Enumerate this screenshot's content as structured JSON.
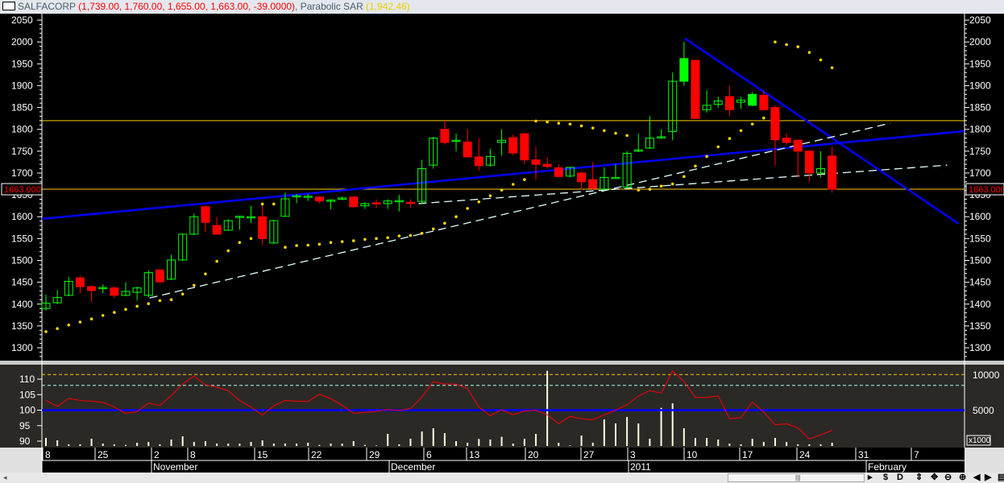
{
  "title": {
    "symbol": "SALFACORP",
    "ohlc": "(1,739.00, 1,760.00, 1,655.00, 1,663.00, -39.0000)",
    "indicator": ", Parabolic SAR",
    "sar_value": "(1,942.46)"
  },
  "price_marker": "1663.000",
  "volume_unit": "x1000",
  "toolbar": {
    "scroll_left": "◂",
    "buttons": [
      {
        "name": "play-icon",
        "glyph": "▸"
      },
      {
        "name": "dollar-icon",
        "glyph": "$"
      },
      {
        "name": "d-icon",
        "glyph": "D"
      },
      {
        "name": "vertical-resize-icon",
        "glyph": "⇕"
      },
      {
        "name": "move-icon",
        "glyph": "✥"
      },
      {
        "name": "zoom-out-icon",
        "glyph": "⊖"
      },
      {
        "name": "zoom-in-icon",
        "glyph": "⊕"
      },
      {
        "name": "prev-icon",
        "glyph": "◀"
      },
      {
        "name": "next-icon",
        "glyph": "▶"
      },
      {
        "name": "menu-icon",
        "glyph": "▤"
      }
    ]
  },
  "colors": {
    "up": "#00ff00",
    "down": "#ff0000",
    "sar": "#ffd700",
    "trend": "#0000ff",
    "level": "#ffcc00",
    "dash": "#e0ffff",
    "osc": "#ff0000",
    "volume": "#ffffe0"
  },
  "chart_data": {
    "type": "candlestick",
    "price_axis": {
      "ticks": [
        1300,
        1350,
        1400,
        1450,
        1500,
        1550,
        1600,
        1650,
        1700,
        1750,
        1800,
        1850,
        1900,
        1950,
        2000,
        2050
      ],
      "range": [
        1290,
        2100
      ]
    },
    "date_ticks": [
      "8",
      "25",
      "2",
      "8",
      "15",
      "22",
      "29",
      "6",
      "13",
      "20",
      "27",
      "3",
      "10",
      "17",
      "24",
      "31",
      "7"
    ],
    "month_labels": [
      "November",
      "December",
      "2011",
      "February"
    ],
    "ohlc": [
      [
        1390,
        1422,
        1385,
        1402
      ],
      [
        1403,
        1432,
        1400,
        1415
      ],
      [
        1420,
        1462,
        1418,
        1452
      ],
      [
        1460,
        1465,
        1425,
        1440
      ],
      [
        1440,
        1443,
        1405,
        1431
      ],
      [
        1436,
        1445,
        1425,
        1438
      ],
      [
        1437,
        1440,
        1414,
        1420
      ],
      [
        1420,
        1450,
        1418,
        1429
      ],
      [
        1427,
        1440,
        1408,
        1437
      ],
      [
        1420,
        1477,
        1416,
        1472
      ],
      [
        1478,
        1480,
        1448,
        1451
      ],
      [
        1457,
        1513,
        1455,
        1501
      ],
      [
        1501,
        1562,
        1499,
        1560
      ],
      [
        1560,
        1607,
        1558,
        1600
      ],
      [
        1623,
        1625,
        1565,
        1587
      ],
      [
        1580,
        1600,
        1578,
        1560
      ],
      [
        1569,
        1594,
        1568,
        1591
      ],
      [
        1599,
        1601,
        1570,
        1601
      ],
      [
        1598,
        1625,
        1585,
        1600
      ],
      [
        1600,
        1627,
        1535,
        1550
      ],
      [
        1540,
        1593,
        1538,
        1591
      ],
      [
        1601,
        1655,
        1600,
        1641
      ],
      [
        1647,
        1652,
        1631,
        1648
      ],
      [
        1646,
        1652,
        1636,
        1647
      ],
      [
        1645,
        1647,
        1630,
        1636
      ],
      [
        1638,
        1640,
        1617,
        1638
      ],
      [
        1640,
        1646,
        1638,
        1643
      ],
      [
        1645,
        1647,
        1620,
        1623
      ],
      [
        1625,
        1633,
        1618,
        1630
      ],
      [
        1632,
        1640,
        1620,
        1630
      ],
      [
        1630,
        1640,
        1618,
        1636
      ],
      [
        1636,
        1650,
        1612,
        1637
      ],
      [
        1633,
        1640,
        1620,
        1632
      ],
      [
        1635,
        1730,
        1630,
        1710
      ],
      [
        1718,
        1783,
        1710,
        1780
      ],
      [
        1800,
        1820,
        1765,
        1770
      ],
      [
        1775,
        1790,
        1750,
        1775
      ],
      [
        1771,
        1800,
        1735,
        1737
      ],
      [
        1737,
        1780,
        1705,
        1717
      ],
      [
        1718,
        1755,
        1715,
        1738
      ],
      [
        1770,
        1800,
        1740,
        1775
      ],
      [
        1781,
        1788,
        1740,
        1746
      ],
      [
        1790,
        1792,
        1720,
        1730
      ],
      [
        1730,
        1760,
        1685,
        1720
      ],
      [
        1720,
        1737,
        1710,
        1715
      ],
      [
        1712,
        1720,
        1690,
        1692
      ],
      [
        1693,
        1713,
        1690,
        1713
      ],
      [
        1700,
        1703,
        1662,
        1680
      ],
      [
        1685,
        1725,
        1662,
        1665
      ],
      [
        1663,
        1713,
        1660,
        1690
      ],
      [
        1690,
        1720,
        1690,
        1690
      ],
      [
        1668,
        1750,
        1666,
        1745
      ],
      [
        1750,
        1790,
        1748,
        1753
      ],
      [
        1757,
        1830,
        1755,
        1780
      ],
      [
        1783,
        1800,
        1780,
        1783
      ],
      [
        1795,
        1930,
        1775,
        1910
      ],
      [
        1910,
        2000,
        1900,
        1962
      ],
      [
        1958,
        1958,
        1825,
        1825
      ],
      [
        1845,
        1890,
        1838,
        1855
      ],
      [
        1857,
        1875,
        1850,
        1865
      ],
      [
        1875,
        1900,
        1830,
        1845
      ],
      [
        1862,
        1875,
        1847,
        1867
      ],
      [
        1855,
        1885,
        1853,
        1880
      ],
      [
        1878,
        1887,
        1843,
        1845
      ],
      [
        1850,
        1855,
        1717,
        1776
      ],
      [
        1780,
        1790,
        1765,
        1770
      ],
      [
        1775,
        1777,
        1690,
        1750
      ],
      [
        1750,
        1752,
        1680,
        1700
      ],
      [
        1700,
        1750,
        1690,
        1710
      ],
      [
        1739,
        1760,
        1655,
        1663
      ]
    ],
    "filled_up": [
      56,
      62,
      69
    ],
    "sar": [
      1337,
      1344,
      1352,
      1359,
      1366,
      1374,
      1381,
      1388,
      1395,
      1401,
      1408,
      1410,
      1423,
      1443,
      1469,
      1498,
      1522,
      1541,
      1550,
      1629,
      1629,
      1530,
      1534,
      1535,
      1537,
      1541,
      1543,
      1545,
      1548,
      1550,
      1552,
      1556,
      1557,
      1562,
      1572,
      1585,
      1600,
      1619,
      1634,
      1648,
      1661,
      1674,
      1685,
      1819,
      1817,
      1814,
      1812,
      1808,
      1803,
      1797,
      1791,
      1786,
      1661,
      1663,
      1670,
      1675,
      1692,
      1716,
      1738,
      1760,
      1779,
      1797,
      1812,
      1826,
      2000,
      1994,
      1989,
      1976,
      1959,
      1941
    ],
    "horizontal_levels": [
      1820,
      1663
    ],
    "trendlines": [
      {
        "kind": "solid",
        "from": [
          -0.35,
          1595
        ],
        "to": [
          80.6,
          1796
        ]
      },
      {
        "kind": "solid",
        "from": [
          56.1,
          2008
        ],
        "to": [
          80.1,
          1584
        ]
      },
      {
        "kind": "dashed",
        "from": [
          9.1,
          1414
        ],
        "to": [
          74.1,
          1814
        ]
      },
      {
        "kind": "dashed",
        "from": [
          32.7,
          1630
        ],
        "to": [
          79.1,
          1718
        ]
      }
    ],
    "oscillator": {
      "axis_ticks": [
        90,
        95,
        100,
        105,
        110
      ],
      "baseline": 100,
      "upper_levels": [
        111.5,
        108
      ],
      "values": [
        103.2,
        101.2,
        103.8,
        103.1,
        102.9,
        102.5,
        101,
        99,
        99.5,
        102.3,
        101.5,
        104.7,
        108.4,
        111,
        108.2,
        107.4,
        106.3,
        103.1,
        101,
        98.4,
        101.4,
        103.1,
        102.9,
        102.8,
        105.1,
        103.7,
        101.6,
        99,
        99.3,
        99.6,
        100.2,
        99.9,
        100.5,
        104.2,
        109.2,
        108.4,
        108.4,
        107,
        101,
        98.2,
        100.1,
        98.5,
        99.7,
        100,
        98.5,
        95.6,
        98,
        97.2,
        96.9,
        98.5,
        100,
        101.7,
        104.6,
        106.3,
        105.5,
        112.6,
        109.3,
        104.1,
        104.1,
        104.6,
        97.2,
        97.6,
        102.6,
        99.4,
        95.3,
        95.6,
        94.3,
        90.7,
        92,
        93.5
      ]
    },
    "volume": {
      "axis_ticks": [
        5000,
        10000
      ],
      "values": [
        1137,
        796,
        227,
        227,
        1023,
        341,
        227,
        152,
        455,
        569,
        227,
        910,
        1364,
        569,
        682,
        341,
        341,
        341,
        569,
        796,
        341,
        341,
        341,
        455,
        152,
        341,
        341,
        682,
        152,
        76,
        1706,
        227,
        1023,
        2047,
        2501,
        1819,
        682,
        455,
        985,
        910,
        1289,
        341,
        1023,
        1706,
        10612,
        455,
        76,
        1478,
        455,
        3752,
        3184,
        4093,
        3184,
        1023,
        5382,
        6026,
        2501,
        1137,
        1137,
        910,
        341,
        227,
        1023,
        569,
        1137,
        569,
        227,
        227,
        227,
        455
      ]
    }
  }
}
